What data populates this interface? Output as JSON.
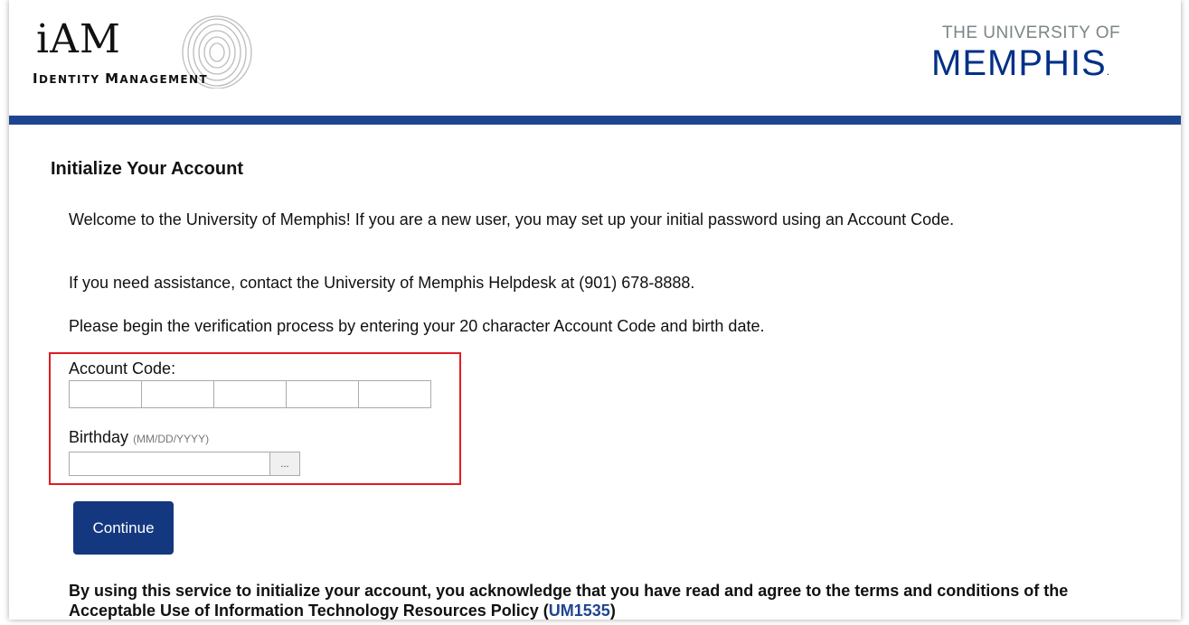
{
  "header": {
    "iam_logo_main": "iAM",
    "iam_logo_sub_first": "I",
    "iam_logo_sub_rest": "DENTITY ",
    "iam_logo_sub_m": "M",
    "iam_logo_sub_rest2": "ANAGEMENT",
    "university_line1": "THE UNIVERSITY OF",
    "university_line2": "MEMPHIS",
    "university_dot": "."
  },
  "colors": {
    "accent_bar": "#1d4590",
    "button": "#14387f",
    "highlight_border": "#e11b22",
    "brand_blue": "#003087"
  },
  "main": {
    "title": "Initialize Your Account",
    "welcome": "Welcome to the University of Memphis! If you are a new user, you may set up your initial password using an Account Code.",
    "assistance": "If you need assistance, contact the University of Memphis Helpdesk at (901) 678-8888.",
    "instructions": "Please begin the verification process by entering your 20 character Account Code and birth date.",
    "account_code_label": "Account Code:",
    "account_code_segments": [
      "",
      "",
      "",
      "",
      ""
    ],
    "birthday_label": "Birthday",
    "birthday_hint": "(MM/DD/YYYY)",
    "birthday_value": "",
    "date_picker_label": "...",
    "continue_label": "Continue",
    "terms_text": "By using this service to initialize your account, you acknowledge that you have read and agree to the terms and conditions of the Acceptable Use of Information Technology Resources Policy (",
    "terms_link": "UM1535",
    "terms_close": ")"
  }
}
